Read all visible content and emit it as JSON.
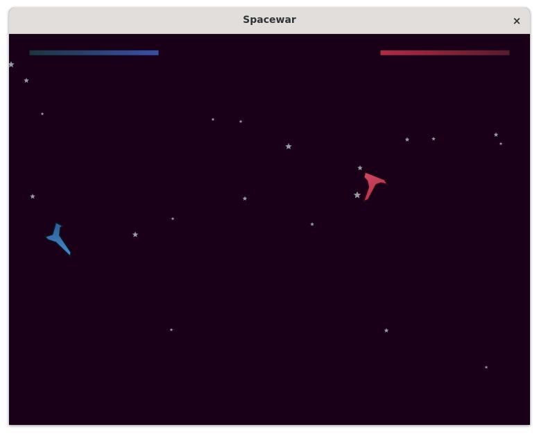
{
  "window": {
    "title": "Spacewar",
    "close_label": "×"
  },
  "game": {
    "background": "#190018",
    "player1": {
      "name": "blue-ship",
      "color": "#3a6fb0",
      "health": 1.0,
      "health_color": "#3a4fa0"
    },
    "player2": {
      "name": "red-ship",
      "color": "#c03a55",
      "health": 1.0,
      "health_color": "#a82a42"
    },
    "star_color": "#9a9aa2"
  }
}
